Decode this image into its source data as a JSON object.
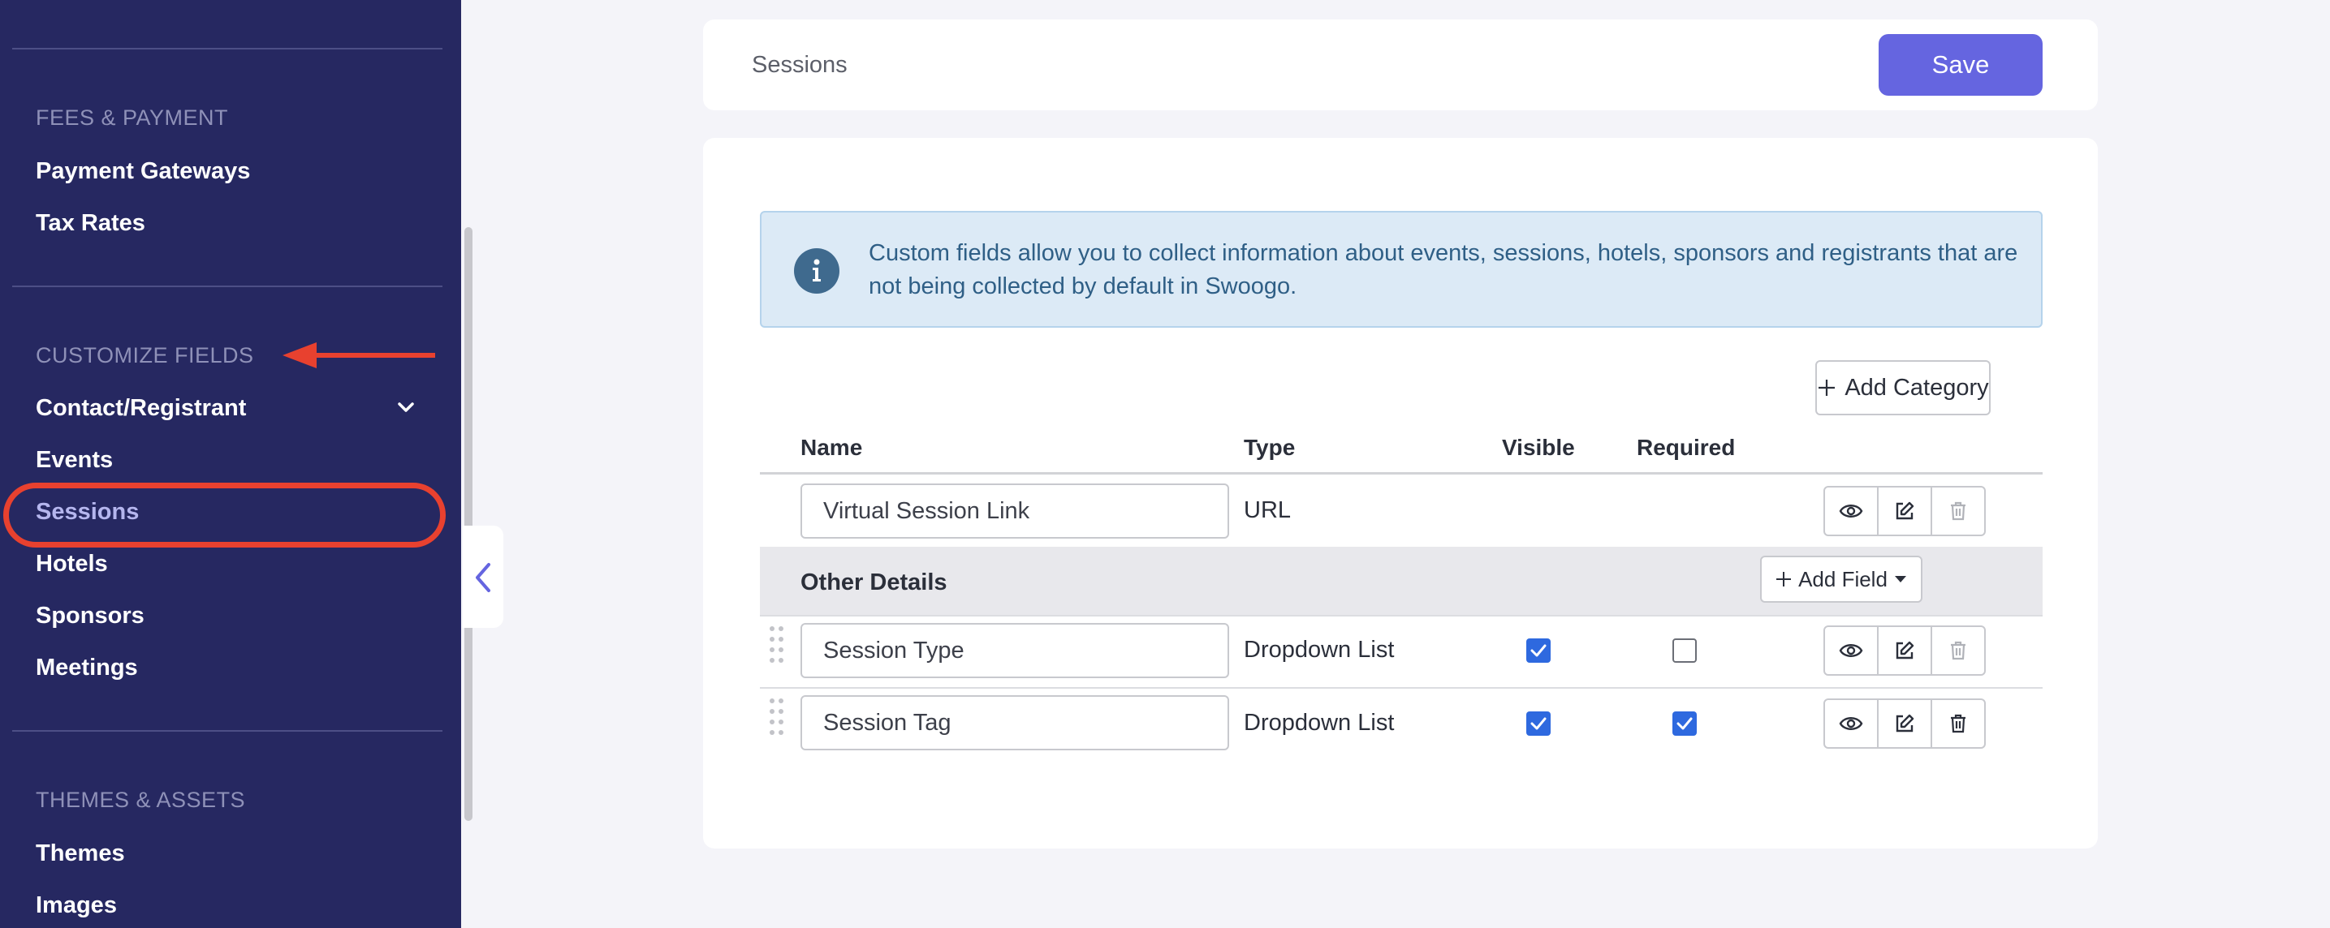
{
  "sidebar": {
    "sections": [
      {
        "heading": "FEES & PAYMENT",
        "items": [
          "Payment Gateways",
          "Tax Rates"
        ]
      },
      {
        "heading": "CUSTOMIZE FIELDS",
        "items": [
          "Contact/Registrant",
          "Events",
          "Sessions",
          "Hotels",
          "Sponsors",
          "Meetings"
        ]
      },
      {
        "heading": "THEMES & ASSETS",
        "items": [
          "Themes",
          "Images"
        ]
      }
    ],
    "active_item": "Sessions"
  },
  "header": {
    "title": "Sessions",
    "save_label": "Save"
  },
  "info": {
    "text": "Custom fields allow you to collect information about events, sessions, hotels, sponsors and registrants that are not being collected by default in Swoogo."
  },
  "toolbar": {
    "add_category_label": "Add Category"
  },
  "table": {
    "columns": [
      "Name",
      "Type",
      "Visible",
      "Required"
    ],
    "uncategorized_rows": [
      {
        "name": "Virtual Session Link",
        "type": "URL"
      }
    ],
    "category": {
      "name": "Other Details",
      "add_field_label": "Add Field",
      "rows": [
        {
          "name": "Session Type",
          "type": "Dropdown List",
          "visible": true,
          "required": false
        },
        {
          "name": "Session Tag",
          "type": "Dropdown List",
          "visible": true,
          "required": true
        }
      ]
    }
  },
  "colors": {
    "sidebar_bg": "#262861",
    "accent": "#6565e0",
    "checkbox": "#2e69df",
    "annotation": "#e8412f"
  }
}
